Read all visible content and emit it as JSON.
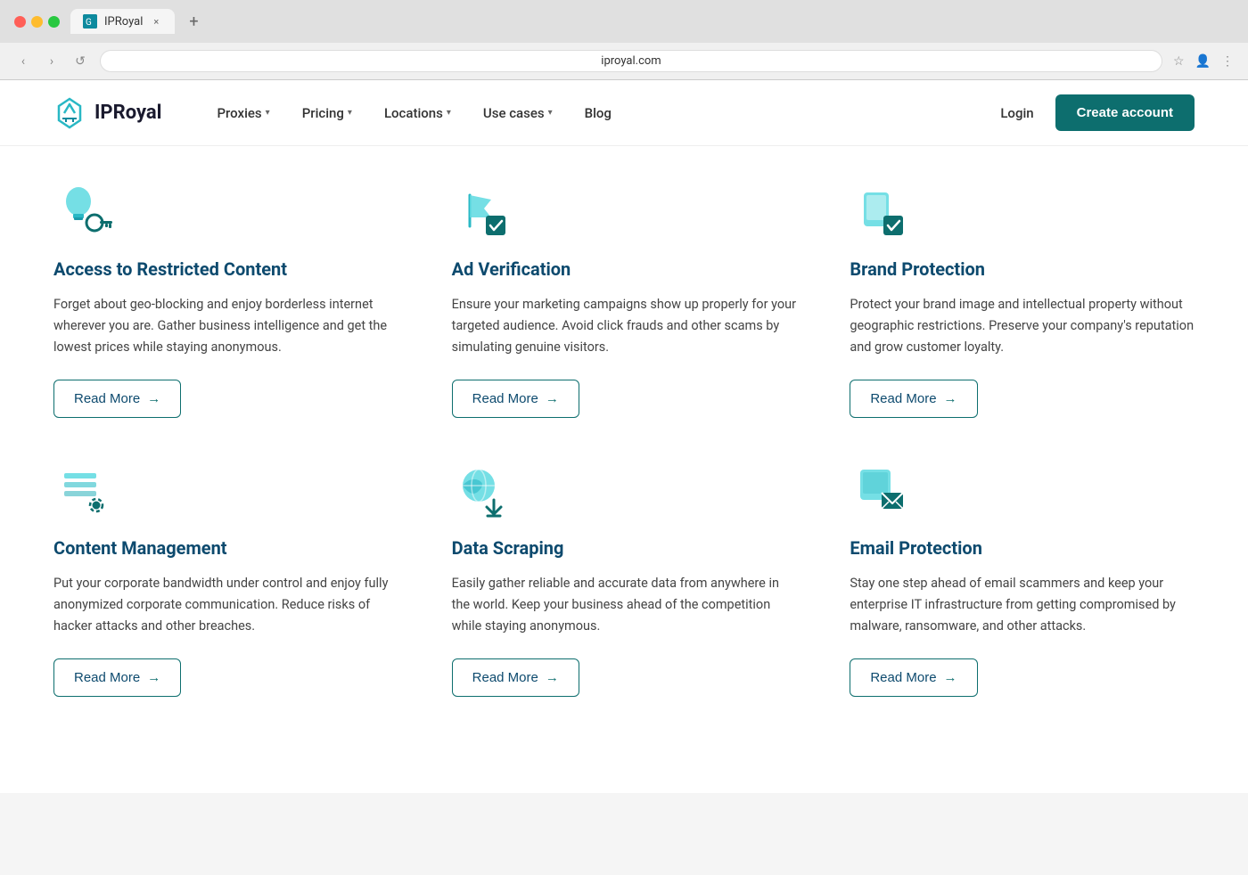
{
  "browser": {
    "tab_label": "IPRoyal",
    "tab_close": "×",
    "tab_new": "+",
    "nav_back": "‹",
    "nav_forward": "›",
    "nav_refresh": "↺",
    "address": "iproyal.com",
    "action_star": "☆",
    "action_profile": "👤",
    "action_menu": "⋮"
  },
  "navbar": {
    "logo_text": "IPRoyal",
    "nav_items": [
      {
        "label": "Proxies",
        "has_chevron": true
      },
      {
        "label": "Pricing",
        "has_chevron": true
      },
      {
        "label": "Locations",
        "has_chevron": true
      },
      {
        "label": "Use cases",
        "has_chevron": true
      },
      {
        "label": "Blog",
        "has_chevron": false
      }
    ],
    "login_label": "Login",
    "create_account_label": "Create account"
  },
  "cards": [
    {
      "id": "access-restricted",
      "title": "Access to Restricted Content",
      "description": "Forget about geo-blocking and enjoy borderless internet wherever you are. Gather business intelligence and get the lowest prices while staying anonymous.",
      "btn_label": "Read More",
      "icon_type": "key"
    },
    {
      "id": "ad-verification",
      "title": "Ad Verification",
      "description": "Ensure your marketing campaigns show up properly for your targeted audience. Avoid click frauds and other scams by simulating genuine visitors.",
      "btn_label": "Read More",
      "icon_type": "check-flag"
    },
    {
      "id": "brand-protection",
      "title": "Brand Protection",
      "description": "Protect your brand image and intellectual property without geographic restrictions. Preserve your company's reputation and grow customer loyalty.",
      "btn_label": "Read More",
      "icon_type": "shield-check"
    },
    {
      "id": "content-management",
      "title": "Content Management",
      "description": "Put your corporate bandwidth under control and enjoy fully anonymized corporate communication. Reduce risks of hacker attacks and other breaches.",
      "btn_label": "Read More",
      "icon_type": "gear-list"
    },
    {
      "id": "data-scraping",
      "title": "Data Scraping",
      "description": "Easily gather reliable and accurate data from anywhere in the world. Keep your business ahead of the competition while staying anonymous.",
      "btn_label": "Read More",
      "icon_type": "download-globe"
    },
    {
      "id": "email-protection",
      "title": "Email Protection",
      "description": "Stay one step ahead of email scammers and keep your enterprise IT infrastructure from getting compromised by malware, ransomware, and other attacks.",
      "btn_label": "Read More",
      "icon_type": "envelope-shield"
    }
  ],
  "colors": {
    "teal_dark": "#0d6e6e",
    "teal_light": "#00c8c8",
    "navy": "#0d4a6e",
    "icon_primary": "#29b8c5",
    "icon_secondary": "#0d8a9e"
  }
}
